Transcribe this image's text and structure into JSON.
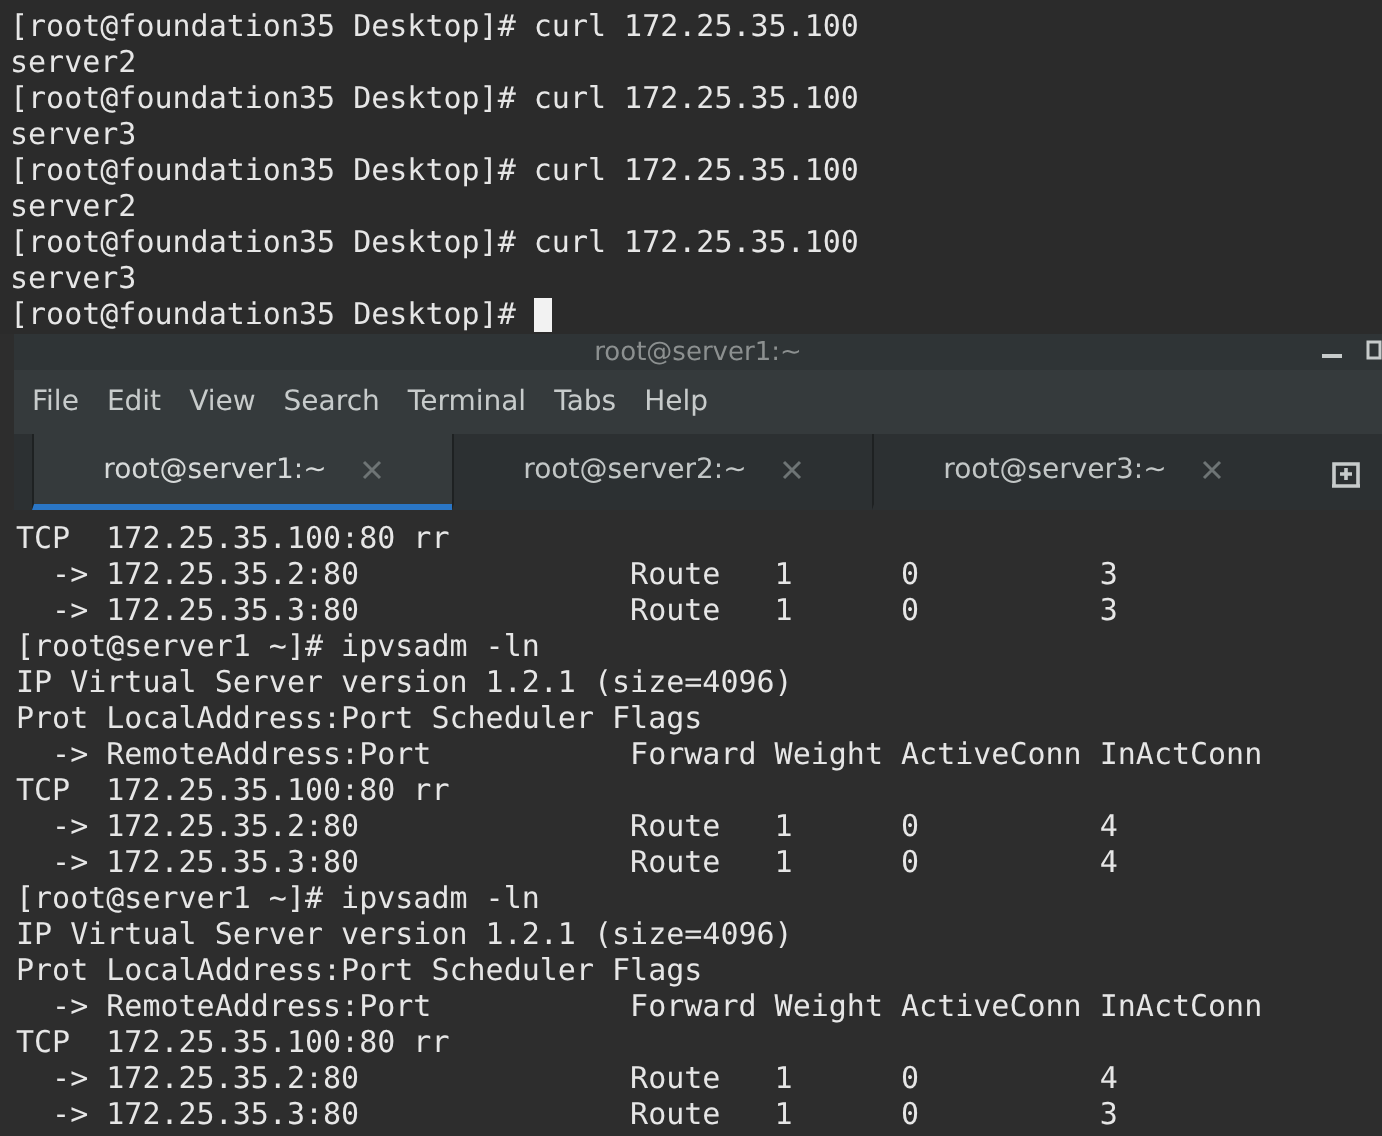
{
  "host_terminal": {
    "lines": [
      "[root@foundation35 Desktop]# curl 172.25.35.100",
      "server2",
      "[root@foundation35 Desktop]# curl 172.25.35.100",
      "server3",
      "[root@foundation35 Desktop]# curl 172.25.35.100",
      "server2",
      "[root@foundation35 Desktop]# curl 172.25.35.100",
      "server3",
      "[root@foundation35 Desktop]# "
    ]
  },
  "window": {
    "title": "root@server1:~",
    "menu": [
      "File",
      "Edit",
      "View",
      "Search",
      "Terminal",
      "Tabs",
      "Help"
    ],
    "tabs": [
      {
        "label": "root@server1:~",
        "selected": true
      },
      {
        "label": "root@server2:~",
        "selected": false
      },
      {
        "label": "root@server3:~",
        "selected": false
      }
    ],
    "terminal": {
      "lines": [
        "TCP  172.25.35.100:80 rr",
        "  -> 172.25.35.2:80               Route   1      0          3",
        "  -> 172.25.35.3:80               Route   1      0          3",
        "[root@server1 ~]# ipvsadm -ln",
        "IP Virtual Server version 1.2.1 (size=4096)",
        "Prot LocalAddress:Port Scheduler Flags",
        "  -> RemoteAddress:Port           Forward Weight ActiveConn InActConn",
        "TCP  172.25.35.100:80 rr",
        "  -> 172.25.35.2:80               Route   1      0          4",
        "  -> 172.25.35.3:80               Route   1      0          4",
        "[root@server1 ~]# ipvsadm -ln",
        "IP Virtual Server version 1.2.1 (size=4096)",
        "Prot LocalAddress:Port Scheduler Flags",
        "  -> RemoteAddress:Port           Forward Weight ActiveConn InActConn",
        "TCP  172.25.35.100:80 rr",
        "  -> 172.25.35.2:80               Route   1      0          4",
        "  -> 172.25.35.3:80               Route   1      0          3"
      ]
    }
  }
}
